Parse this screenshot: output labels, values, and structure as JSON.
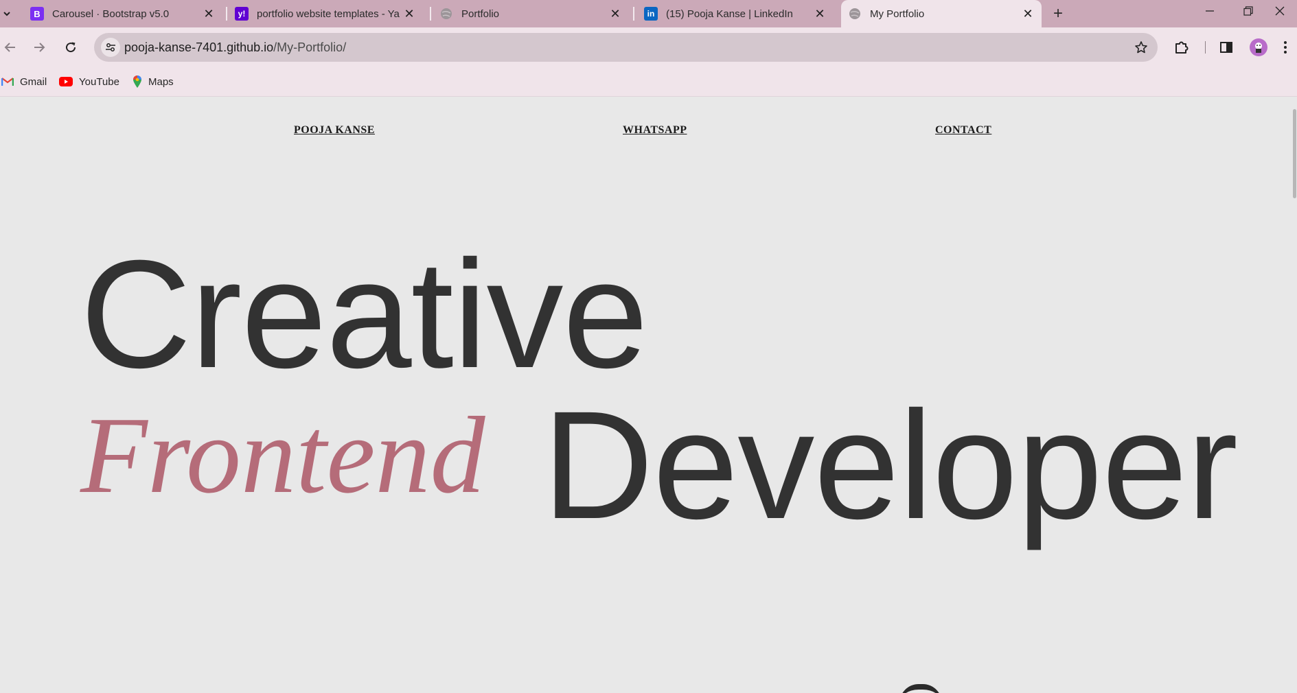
{
  "browser": {
    "tabs": [
      {
        "title": "Carousel · Bootstrap v5.0",
        "favicon": "bootstrap-icon",
        "active": false
      },
      {
        "title": "portfolio website templates - Ya",
        "favicon": "yahoo-icon",
        "active": false
      },
      {
        "title": "Portfolio",
        "favicon": "globe-icon",
        "active": false
      },
      {
        "title": "(15) Pooja Kanse | LinkedIn",
        "favicon": "linkedin-icon",
        "active": false
      },
      {
        "title": "My Portfolio",
        "favicon": "globe-icon",
        "active": true
      }
    ],
    "address": {
      "host": "pooja-kanse-7401.github.io",
      "path": "/My-Portfolio/"
    },
    "bookmarks": [
      {
        "label": "Gmail",
        "icon": "gmail-icon"
      },
      {
        "label": "YouTube",
        "icon": "youtube-icon"
      },
      {
        "label": "Maps",
        "icon": "maps-icon"
      }
    ],
    "colors": {
      "tabstrip": "#cba9b8",
      "toolbar": "#f0e4ea",
      "omnibox": "#d4c7ce"
    }
  },
  "page": {
    "nav": {
      "name": "POOJA KANSE",
      "whatsapp": "WHATSAPP",
      "contact": "CONTACT"
    },
    "hero": {
      "line1": "Creative",
      "line2_accent": "Frontend",
      "line2_main": "Developer"
    },
    "colors": {
      "background": "#e8e8e8",
      "text": "#323232",
      "accent": "#b56c79"
    }
  }
}
